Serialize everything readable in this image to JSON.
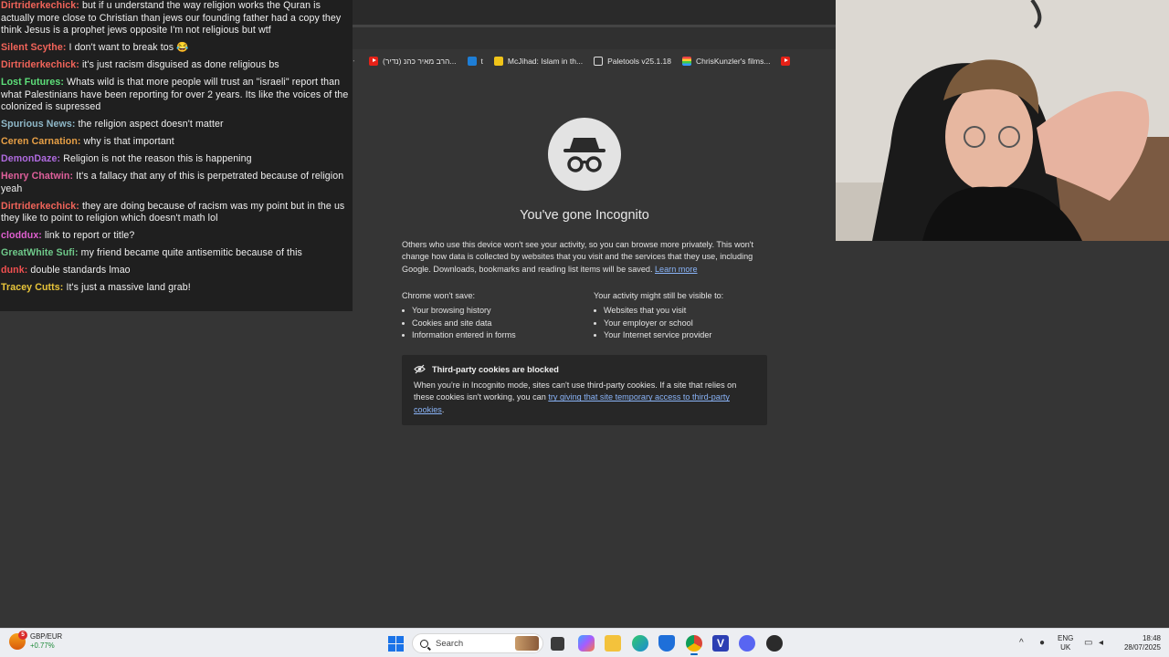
{
  "chat": {
    "messages": [
      {
        "user": "Dirtriderkechick:",
        "color": "#f2645a",
        "text": "but if u understand the way religion works the Quran is actually more close to Christian than jews our founding father had a copy they think Jesus is a prophet jews opposite I'm not religious but wtf"
      },
      {
        "user": "Silent Scythe:",
        "color": "#f2645a",
        "text": "I don't want to break tos 😂"
      },
      {
        "user": "Dirtriderkechick:",
        "color": "#f2645a",
        "text": "it's just racism disguised as done religious bs"
      },
      {
        "user": "Lost Futures:",
        "color": "#5ee07a",
        "text": "Whats wild is that more people will trust an \"israeli\" report than what Palestinians have been reporting for over 2 years. Its like the voices of the colonized is supressed"
      },
      {
        "user": "Spurious News:",
        "color": "#8fb8c8",
        "text": "the religion aspect doesn't matter"
      },
      {
        "user": "Ceren Carnation:",
        "color": "#e8a046",
        "text": "why is that important"
      },
      {
        "user": "DemonDaze:",
        "color": "#b06be0",
        "text": "Religion is not the reason this is happening"
      },
      {
        "user": "Henry Chatwin:",
        "color": "#e0609c",
        "text": "It's a fallacy that any of this is perpetrated because of religion yeah"
      },
      {
        "user": "Dirtriderkechick:",
        "color": "#f2645a",
        "text": "they are doing because of racism was my point but in the us they like to point to religion which doesn't math lol"
      },
      {
        "user": "cloddux:",
        "color": "#e05fd0",
        "text": "link to report or title?"
      },
      {
        "user": "GreatWhite Sufi:",
        "color": "#6fc98a",
        "text": "my friend became quite antisemitic because of this"
      },
      {
        "user": "dunk:",
        "color": "#f25050",
        "text": "double standards lmao"
      },
      {
        "user": "Tracey Cutts:",
        "color": "#e8c53a",
        "text": "It's just a massive land grab!"
      }
    ]
  },
  "bookmarks": [
    {
      "icon": "youtube-icon",
      "label": "(נדיר) הרב מאיר כהנ..."
    },
    {
      "icon": "blue-square-icon",
      "label": "t"
    },
    {
      "icon": "pin-icon",
      "label": "McJihad: Islam in th..."
    },
    {
      "icon": "globe-icon",
      "label": "Paletools v25.1.18"
    },
    {
      "icon": "rainbow-icon",
      "label": "ChrisKunzler's films..."
    },
    {
      "icon": "youtube-icon",
      "label": ""
    }
  ],
  "incognito": {
    "title": "You've gone Incognito",
    "description": "Others who use this device won't see your activity, so you can browse more privately. This won't change how data is collected by websites that you visit and the services that they use, including Google. Downloads, bookmarks and reading list items will be saved.",
    "learn_more": "Learn more",
    "wont_save_heading": "Chrome won't save:",
    "wont_save_items": [
      "Your browsing history",
      "Cookies and site data",
      "Information entered in forms"
    ],
    "visible_heading": "Your activity might still be visible to:",
    "visible_items": [
      "Websites that you visit",
      "Your employer or school",
      "Your Internet service provider"
    ],
    "cookies_heading": "Third-party cookies are blocked",
    "cookies_text": "When you're in Incognito mode, sites can't use third-party cookies. If a site that relies on these cookies isn't working, you can ",
    "cookies_link": "try giving that site temporary access to third-party cookies",
    "cookies_end": "."
  },
  "taskbar": {
    "widget_pair": "GBP/EUR",
    "widget_change": "+0.77%",
    "widget_badge": "5",
    "search_placeholder": "Search",
    "lang_top": "ENG",
    "lang_bottom": "UK",
    "time": "18:48",
    "date": "28/07/2025"
  },
  "colors": {
    "accent_link": "#8ab4f8",
    "page_bg": "#353535",
    "chat_bg": "#1f1f1f"
  }
}
